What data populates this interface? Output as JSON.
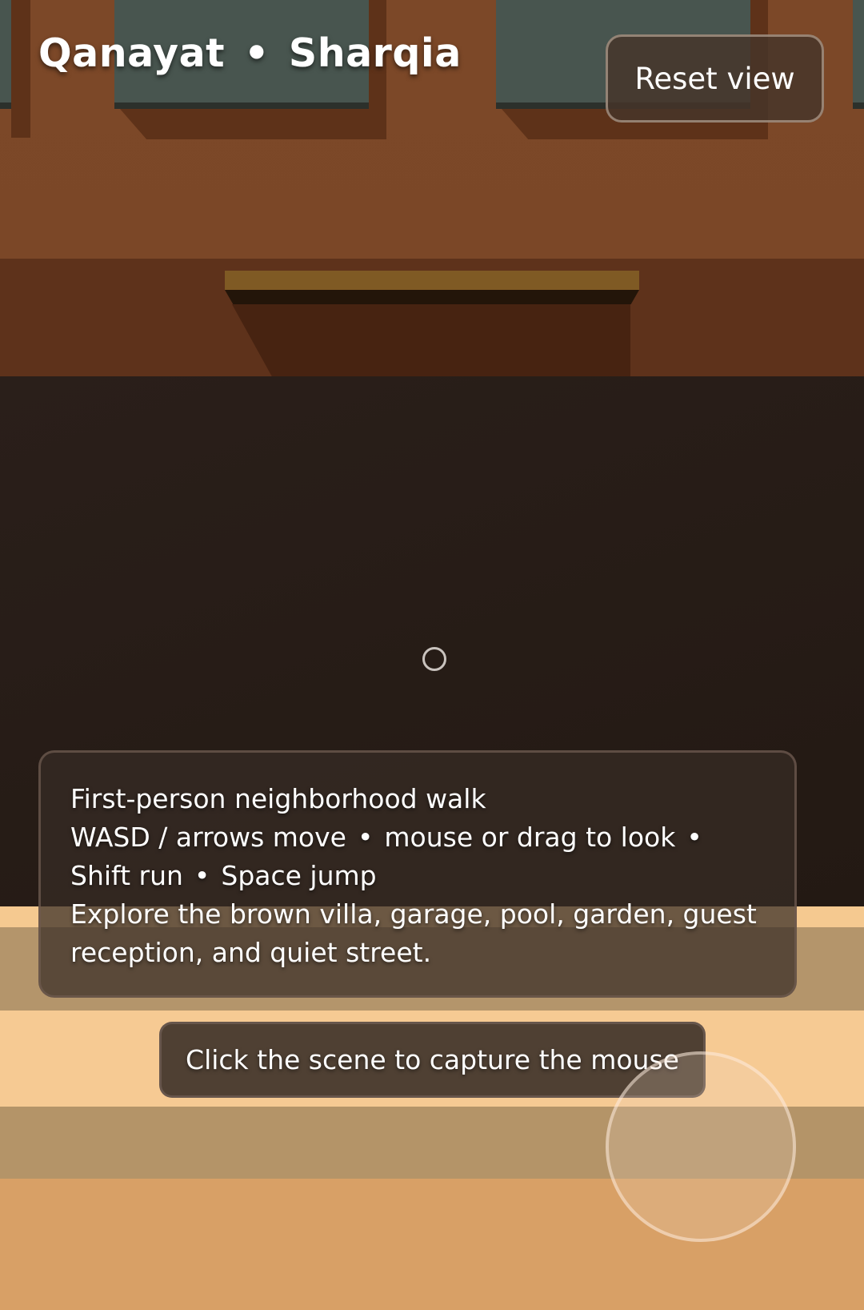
{
  "hud": {
    "location": {
      "town": "Qanayat",
      "separator": "•",
      "region": "Sharqia"
    },
    "reset_label": "Reset view"
  },
  "info": {
    "heading": "First-person neighborhood walk",
    "controls_line1": {
      "move": "WASD / arrows move",
      "sep1": "•",
      "look": "mouse or drag to look",
      "sep2": "•"
    },
    "controls_line2": {
      "run": "Shift run",
      "sep": "•",
      "jump": "Space jump"
    },
    "description": "Explore the brown villa, garage, pool, garden, guest reception, and quiet street."
  },
  "capture_hint": "Click the scene to capture the mouse",
  "colors": {
    "wall": "#7c4828",
    "wall_dark": "#5e321b",
    "window": "#48554f",
    "ground_light": "#f6ca93",
    "ground_dark": "#b4956b",
    "panel": "#382c26"
  }
}
